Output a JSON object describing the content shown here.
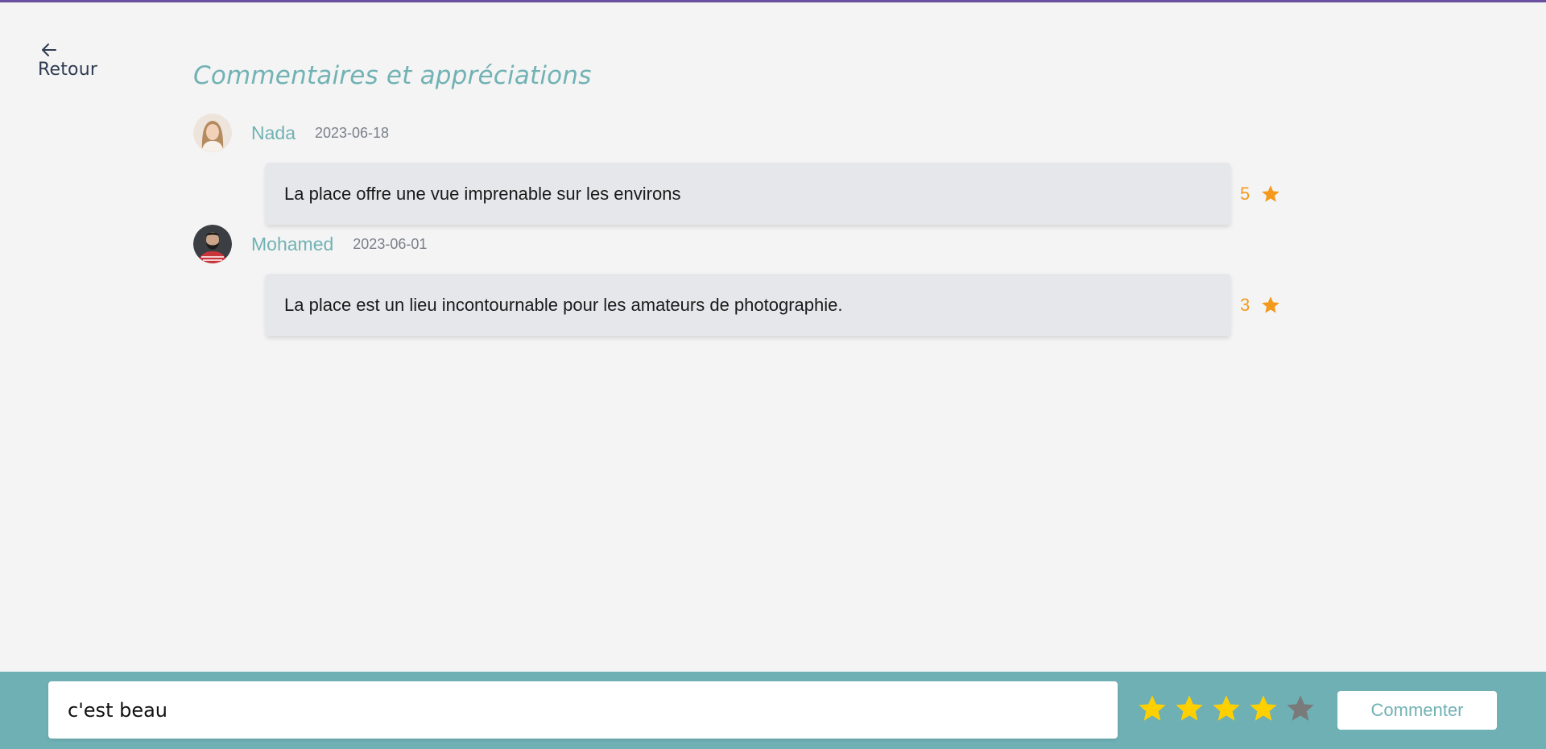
{
  "nav": {
    "back_label": "Retour",
    "back_icon": "arrow-left-icon"
  },
  "page": {
    "title": "Commentaires et appréciations"
  },
  "comments": [
    {
      "user": "Nada",
      "date": "2023-06-18",
      "text": "La place offre une vue imprenable sur les environs",
      "rating": "5"
    },
    {
      "user": "Mohamed",
      "date": "2023-06-01",
      "text": "La place est un lieu incontournable pour les amateurs de photographie.",
      "rating": "3"
    }
  ],
  "composer": {
    "input_value": "c'est beau",
    "selected_rating": 4,
    "max_rating": 5,
    "submit_label": "Commenter"
  },
  "colors": {
    "accent": "#72b2b4",
    "footer": "#6fb0b4",
    "rating": "#f39a1d",
    "star_active": "#ffd000",
    "star_inactive": "#7a7a7a",
    "top_bar": "#6b4fa1"
  }
}
